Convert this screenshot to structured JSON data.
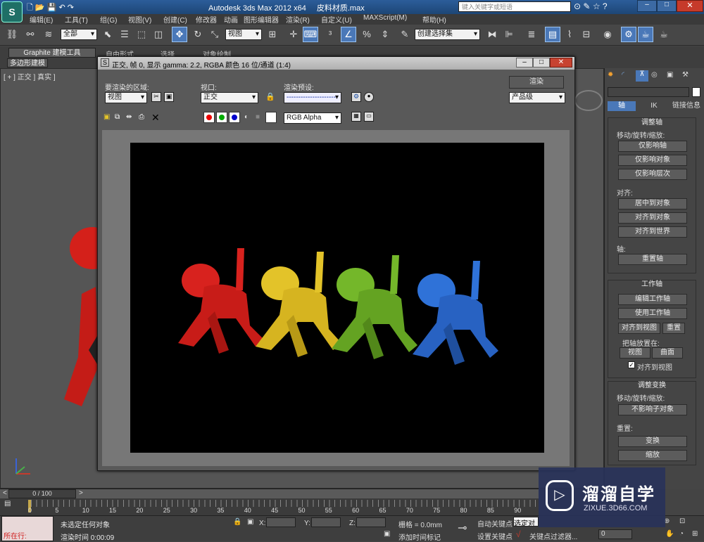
{
  "titlebar": {
    "app": "Autodesk 3ds Max  2012 x64",
    "file": "皮料材质.max",
    "search_placeholder": "键入关键字或短语"
  },
  "menu": [
    "编辑(E)",
    "工具(T)",
    "组(G)",
    "视图(V)",
    "创建(C)",
    "修改器",
    "动画",
    "图形编辑器",
    "渲染(R)",
    "自定义(U)",
    "MAXScript(M)",
    "帮助(H)"
  ],
  "toolbar": {
    "filter": "全部",
    "ref_coord": "视图",
    "named_sel": "创建选择集"
  },
  "ribbon": {
    "tabs": [
      "Graphite 建模工具",
      "自由形式",
      "选择",
      "对象绘制"
    ],
    "sub": "多边形建模"
  },
  "viewport_label": "[ + ] 正交 ] 真实 ]",
  "render_window": {
    "title": "正交, 帧 0, 显示 gamma: 2.2, RGBA 颜色 16 位/通道 (1:4)",
    "area_label": "要渲染的区域:",
    "area_value": "视图",
    "viewport_label": "视口:",
    "viewport_value": "正交",
    "preset_label": "渲染预设:",
    "preset_value": "---------------------",
    "render_btn": "渲染",
    "quality_value": "产品级",
    "channel_value": "RGB Alpha"
  },
  "cmd_tabs": [
    "轴",
    "IK",
    "链接信息"
  ],
  "panel": {
    "adjust_pivot": "调整轴",
    "move_rot_scale": "移动/旋转/缩放:",
    "affect_pivot": "仅影响轴",
    "affect_object": "仅影响对象",
    "affect_hier": "仅影响层次",
    "align": "对齐:",
    "center_obj": "居中到对象",
    "align_obj": "对齐到对象",
    "align_world": "对齐到世界",
    "pivot": "轴:",
    "reset_pivot": "重置轴",
    "working_pivot": "工作轴",
    "edit_wp": "编辑工作轴",
    "use_wp": "使用工作轴",
    "align_view": "对齐到视图",
    "reset": "重置",
    "place_pivot": "把轴放置在:",
    "view": "视图",
    "surface": "曲面",
    "align_to_view": "对齐到视图",
    "adjust_transform": "调整变换",
    "move_rot_scale2": "移动/旋转/缩放:",
    "dont_affect": "不影响子对象",
    "reset2": "重置:",
    "transform": "变换",
    "scale": "缩放"
  },
  "timeline": {
    "frame": "0 / 100",
    "ticks": [
      "0",
      "5",
      "10",
      "15",
      "20",
      "25",
      "30",
      "35",
      "40",
      "45",
      "50",
      "55",
      "60",
      "65",
      "70",
      "75",
      "80",
      "85",
      "90"
    ]
  },
  "status": {
    "running": "所在行:",
    "none_selected": "未选定任何对象",
    "render_time": "渲染时间  0:00:09",
    "x": "X:",
    "y": "Y:",
    "z": "Z:",
    "grid": "栅格 = 0.0mm",
    "add_tag": "添加时间标记",
    "auto_key": "自动关键点",
    "set_key": "设置关键点",
    "selected": "选定对象",
    "key_filter": "关键点过滤器...",
    "frame_val": "0"
  },
  "watermark": {
    "title": "溜溜自学",
    "url": "ZIXUE.3D66.COM"
  },
  "colors": {
    "accent": "#4a78b8",
    "dog_red": "#d8221e",
    "dog_yellow": "#e3c329",
    "dog_green": "#74b72a",
    "dog_blue": "#2f72d8"
  }
}
